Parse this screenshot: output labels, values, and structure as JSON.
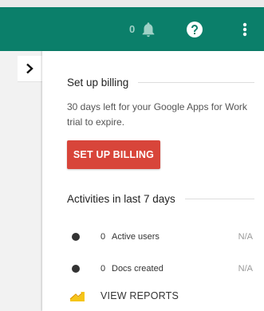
{
  "header": {
    "notification_count": "0",
    "icons": {
      "notifications": "bell-icon",
      "help": "help-icon",
      "more": "more-vert-icon"
    },
    "accent_color": "#0b7f6a"
  },
  "sidebar": {
    "toggle_icon": "chevron-right-icon"
  },
  "billing": {
    "title": "Set up billing",
    "message": "30 days left for your Google Apps for Work trial to expire.",
    "button_label": "SET UP BILLING",
    "button_color": "#d8453a"
  },
  "activities": {
    "title": "Activities in last 7 days",
    "items": [
      {
        "count": "0",
        "label": "Active users",
        "value": "N/A"
      },
      {
        "count": "0",
        "label": "Docs created",
        "value": "N/A"
      }
    ],
    "reports_label": "VIEW REPORTS",
    "reports_icon": "trending-up-icon"
  }
}
